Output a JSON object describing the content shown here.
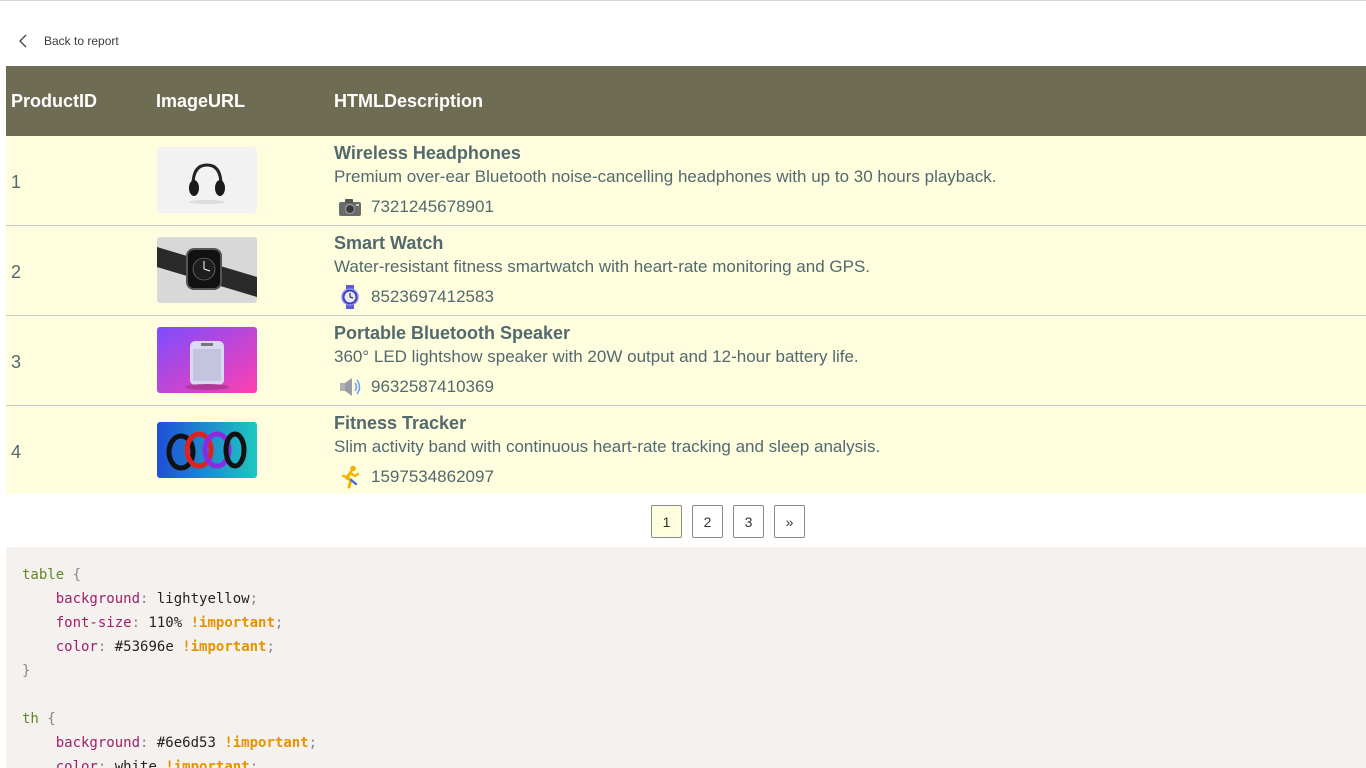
{
  "back_link": {
    "label": "Back to report"
  },
  "table": {
    "headers": [
      "ProductID",
      "ImageURL",
      "HTMLDescription"
    ],
    "rows": [
      {
        "id": "1",
        "title": "Wireless Headphones",
        "description": "Premium over-ear Bluetooth noise-cancelling headphones with up to 30 hours playback.",
        "code": "7321245678901",
        "icon": "camera-icon",
        "image": "headphones-image"
      },
      {
        "id": "2",
        "title": "Smart Watch",
        "description": "Water-resistant fitness smartwatch with heart-rate monitoring and GPS.",
        "code": "8523697412583",
        "icon": "watch-icon",
        "image": "smartwatch-image"
      },
      {
        "id": "3",
        "title": "Portable Bluetooth Speaker",
        "description": "360° LED lightshow speaker with 20W output and 12-hour battery life.",
        "code": "9632587410369",
        "icon": "speaker-icon",
        "image": "speaker-image"
      },
      {
        "id": "4",
        "title": "Fitness Tracker",
        "description": "Slim activity band with continuous heart-rate tracking and sleep analysis.",
        "code": "1597534862097",
        "icon": "runner-icon",
        "image": "fitness-bands-image"
      }
    ]
  },
  "pagination": {
    "pages": [
      "1",
      "2",
      "3"
    ],
    "next": "»",
    "current": "1"
  },
  "code": {
    "l1_sel": "table",
    "l1_brace": " {",
    "l2_prop": "background",
    "l2_val": " lightyellow",
    "l3_prop": "font-size",
    "l3_val": " 110%",
    "l4_prop": "color",
    "l4_val": " #53696e",
    "important": "!important",
    "close": "}",
    "l7_sel": "th",
    "l8_prop": "background",
    "l8_val": " #6e6d53",
    "l9_prop": "color",
    "l9_val": " white"
  },
  "colors": {
    "header_bg": "#6e6d53",
    "row_bg": "#fefedf",
    "text": "#53696e",
    "code_bg": "#f4f1ee"
  }
}
